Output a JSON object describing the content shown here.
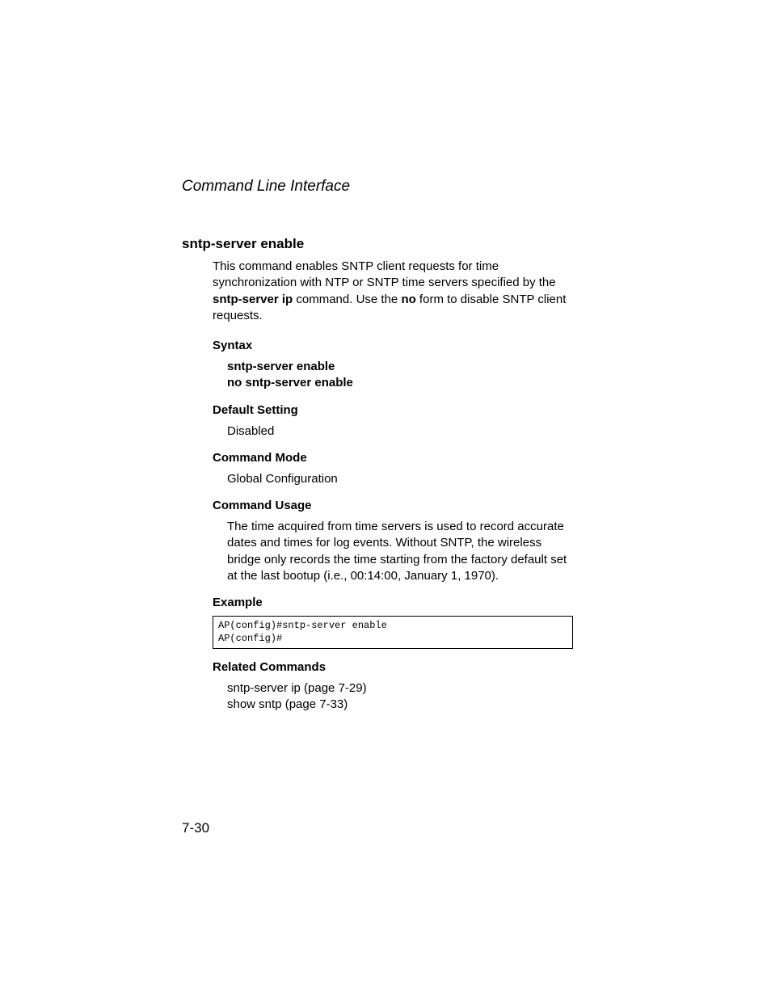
{
  "chapterTitle": "Command Line Interface",
  "commandTitle": "sntp-server enable",
  "descParts": {
    "p1": "This command enables SNTP client requests for time synchronization with NTP or SNTP time servers specified by the ",
    "b1": "sntp-server ip",
    "p2": " command. Use the ",
    "b2": "no",
    "p3": " form to disable SNTP client requests."
  },
  "labels": {
    "syntax": "Syntax",
    "defaultSetting": "Default Setting",
    "commandMode": "Command Mode",
    "commandUsage": "Command Usage",
    "example": "Example",
    "relatedCommands": "Related Commands"
  },
  "syntax": {
    "line1": "sntp-server enable",
    "line2": "no sntp-server enable"
  },
  "defaultSetting": "Disabled",
  "commandMode": "Global Configuration",
  "commandUsage": "The time acquired from time servers is used to record accurate dates and times for log events. Without SNTP, the wireless bridge only records the time starting from the factory default set at the last bootup (i.e., 00:14:00, January 1, 1970).",
  "exampleCode": "AP(config)#sntp-server enable\nAP(config)#",
  "relatedCommands": {
    "line1": "sntp-server ip (page 7-29)",
    "line2": "show sntp (page 7-33)"
  },
  "pageNumber": "7-30"
}
